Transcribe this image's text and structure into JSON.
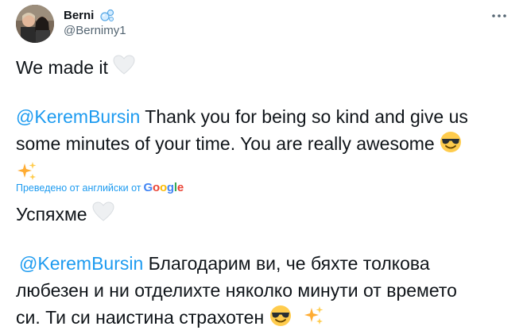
{
  "author": {
    "display_name": "Berni",
    "handle": "@Bernimy1",
    "name_emoji_icon": "bubbles-icon",
    "avatar_icon": "profile-photo-avatar"
  },
  "menu_icon": "more-options-icon",
  "tweet": {
    "line1_text": "We made it ",
    "line1_emoji": "white-heart-icon",
    "mention": "@KeremBursin",
    "line2_rest": " Thank you for being so kind and give us",
    "line3": "some minutes of your time. You are really awesome ",
    "line3_emoji": "smiling-face-with-sunglasses-icon",
    "line4_emoji": "sparkles-icon"
  },
  "translation": {
    "label": "Преведено от английски от",
    "provider": "Google",
    "provider_letters": [
      "G",
      "o",
      "o",
      "g",
      "l",
      "e"
    ],
    "line1_text": "Успяхме ",
    "line1_emoji": "white-heart-icon",
    "mention": "@KeremBursin",
    "line2_rest": " Благодарим ви, че бяхте толкова",
    "line3": "любезен и ни отделихте няколко минути от времето",
    "line4": "си. Ти си наистина страхотен ",
    "line4_emoji1": "smiling-face-with-sunglasses-icon",
    "line4_emoji2": "sparkles-icon"
  },
  "colors": {
    "link": "#1d9bf0",
    "text": "#0f1419",
    "secondary": "#536471"
  }
}
